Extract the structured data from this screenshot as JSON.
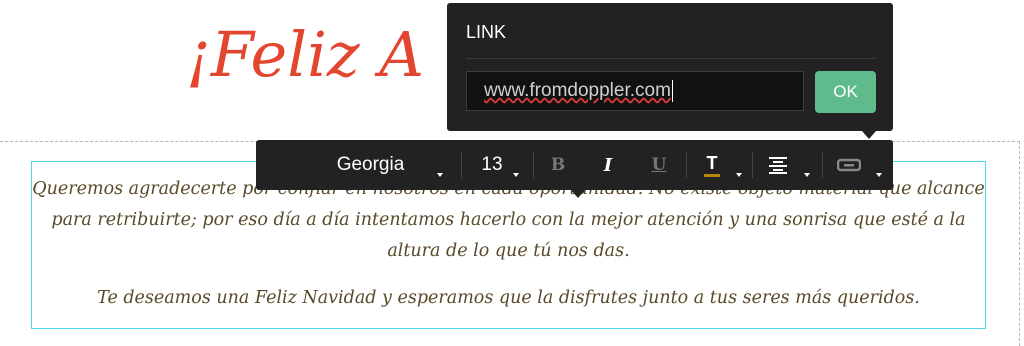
{
  "heading": {
    "text": "¡Feliz A"
  },
  "body": {
    "paragraph1": "Queremos agradecerte por confiar en nosotros en cada oportunidad. No existe objeto material que alcance para retribuirte; por eso día a día intentamos hacerlo con la mejor atención y una sonrisa que esté a la altura de lo que tú nos das.",
    "paragraph2": "Te deseamos una Feliz Navidad y esperamos que la disfrutes junto a tus seres más queridos."
  },
  "toolbar": {
    "font_family": "Georgia",
    "font_size": "13",
    "bold_label": "B",
    "italic_label": "I",
    "underline_label": "U",
    "text_color_label": "T",
    "text_color": "#b8860b"
  },
  "link_dialog": {
    "title": "LINK",
    "url_value": "www.fromdoppler.com",
    "ok_label": "OK"
  },
  "colors": {
    "heading": "#e2462f",
    "body_text": "#5a4a2a",
    "selection_border": "#50d7ec",
    "ok_button": "#5fbb8c",
    "toolbar_bg": "#222222"
  }
}
